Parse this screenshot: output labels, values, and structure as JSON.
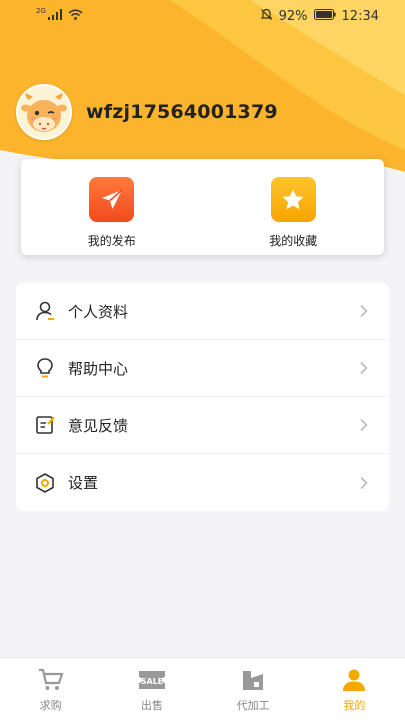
{
  "status_bar": {
    "signal_label": "2G",
    "battery": "92%",
    "time": "12:34"
  },
  "profile": {
    "username": "wfzj17564001379",
    "avatar_icon": "cow-mascot-avatar"
  },
  "quick_actions": [
    {
      "label": "我的发布",
      "icon": "paper-plane-icon",
      "color": "#f14a1c"
    },
    {
      "label": "我的收藏",
      "icon": "star-icon",
      "color": "#f7a400"
    }
  ],
  "menu": [
    {
      "label": "个人资料",
      "icon": "person-icon"
    },
    {
      "label": "帮助中心",
      "icon": "lightbulb-icon"
    },
    {
      "label": "意见反馈",
      "icon": "feedback-icon"
    },
    {
      "label": "设置",
      "icon": "settings-hexagon-icon"
    }
  ],
  "tabs": [
    {
      "label": "求购",
      "icon": "cart-icon",
      "active": false
    },
    {
      "label": "出售",
      "icon": "sale-tag-icon",
      "active": false
    },
    {
      "label": "代加工",
      "icon": "processing-icon",
      "active": false
    },
    {
      "label": "我的",
      "icon": "user-icon",
      "active": true
    }
  ],
  "colors": {
    "accent": "#f5a800",
    "header_dark": "#fbb42c",
    "header_light": "#fdd05a"
  }
}
